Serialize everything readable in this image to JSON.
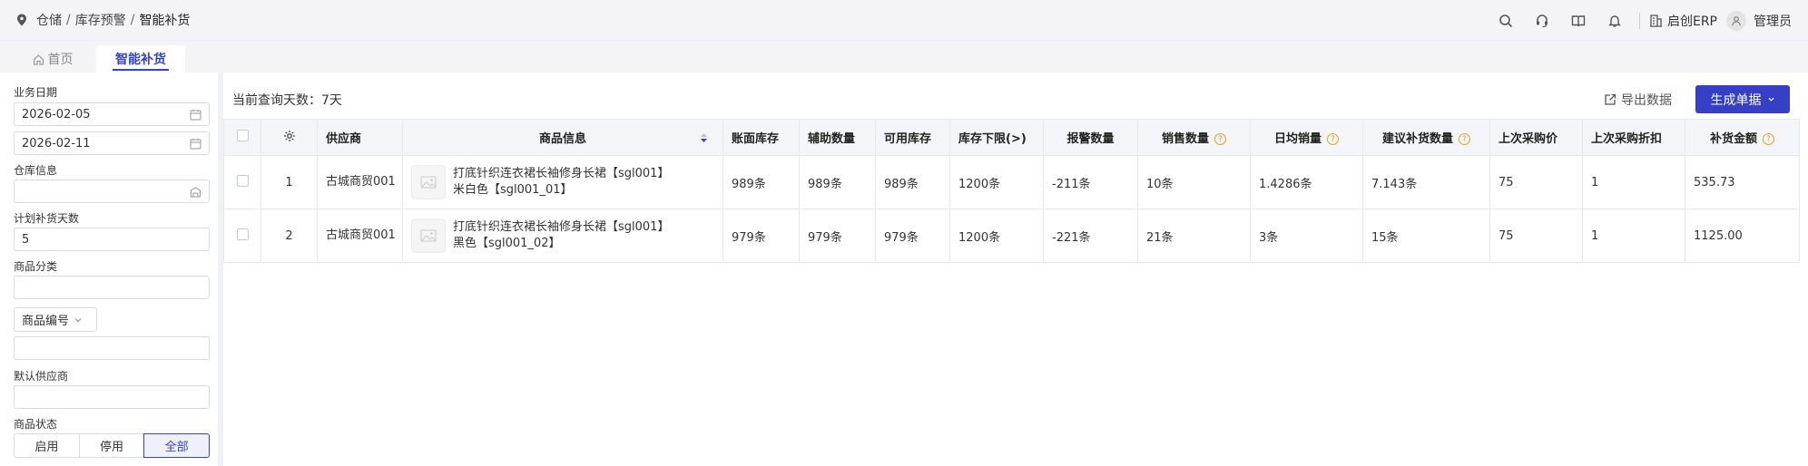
{
  "breadcrumb": {
    "items": [
      "仓储",
      "库存预警",
      "智能补货"
    ],
    "separator": "/"
  },
  "header": {
    "org_name": "启创ERP",
    "user_name": "管理员",
    "icons": [
      "search-icon",
      "headset-icon",
      "book-icon",
      "bell-icon",
      "building-icon",
      "user-icon"
    ]
  },
  "tabs": [
    {
      "label": "首页"
    },
    {
      "label": "智能补货"
    }
  ],
  "filters": {
    "date_label": "业务日期",
    "date_start": "2026-02-05",
    "date_end": "2026-02-11",
    "warehouse_label": "仓库信息",
    "warehouse_value": "",
    "plan_days_label": "计划补货天数",
    "plan_days_value": "5",
    "category_label": "商品分类",
    "category_value": "",
    "code_select_label": "商品编号",
    "code_value": "",
    "supplier_label": "默认供应商",
    "supplier_value": "",
    "status_label": "商品状态",
    "status_options": [
      "启用",
      "停用",
      "全部"
    ],
    "status_selected": "全部"
  },
  "toolbar": {
    "query_days": "当前查询天数：7天",
    "export_label": "导出数据",
    "generate_label": "生成单据"
  },
  "table": {
    "columns": [
      "",
      "",
      "供应商",
      "商品信息",
      "账面库存",
      "辅助数量",
      "可用库存",
      "库存下限(>)",
      "报警数量",
      "销售数量",
      "日均销量",
      "建议补货数量",
      "上次采购价",
      "上次采购折扣",
      "补货金额"
    ],
    "help_columns": [
      "销售数量",
      "日均销量",
      "建议补货数量",
      "补货金额"
    ],
    "rows": [
      {
        "no": "1",
        "supplier": "古城商贸001",
        "product_line1": "打底针织连衣裙长袖修身长裙【sgl001】",
        "product_line2": "米白色【sgl001_01】",
        "book_stock": "989条",
        "aux_qty": "989条",
        "avail_stock": "989条",
        "min_stock": "1200条",
        "alarm_qty": "-211条",
        "sales_qty": "10条",
        "daily_sales": "1.4286条",
        "suggest_qty": "7.143条",
        "last_price": "75",
        "last_discount": "1",
        "amount": "535.73"
      },
      {
        "no": "2",
        "supplier": "古城商贸001",
        "product_line1": "打底针织连衣裙长袖修身长裙【sgl001】",
        "product_line2": "黑色【sgl001_02】",
        "book_stock": "979条",
        "aux_qty": "979条",
        "avail_stock": "979条",
        "min_stock": "1200条",
        "alarm_qty": "-221条",
        "sales_qty": "21条",
        "daily_sales": "3条",
        "suggest_qty": "15条",
        "last_price": "75",
        "last_discount": "1",
        "amount": "1125.00"
      }
    ]
  },
  "colors": {
    "accent": "#3540c5",
    "help_icon": "#e4a11b"
  }
}
